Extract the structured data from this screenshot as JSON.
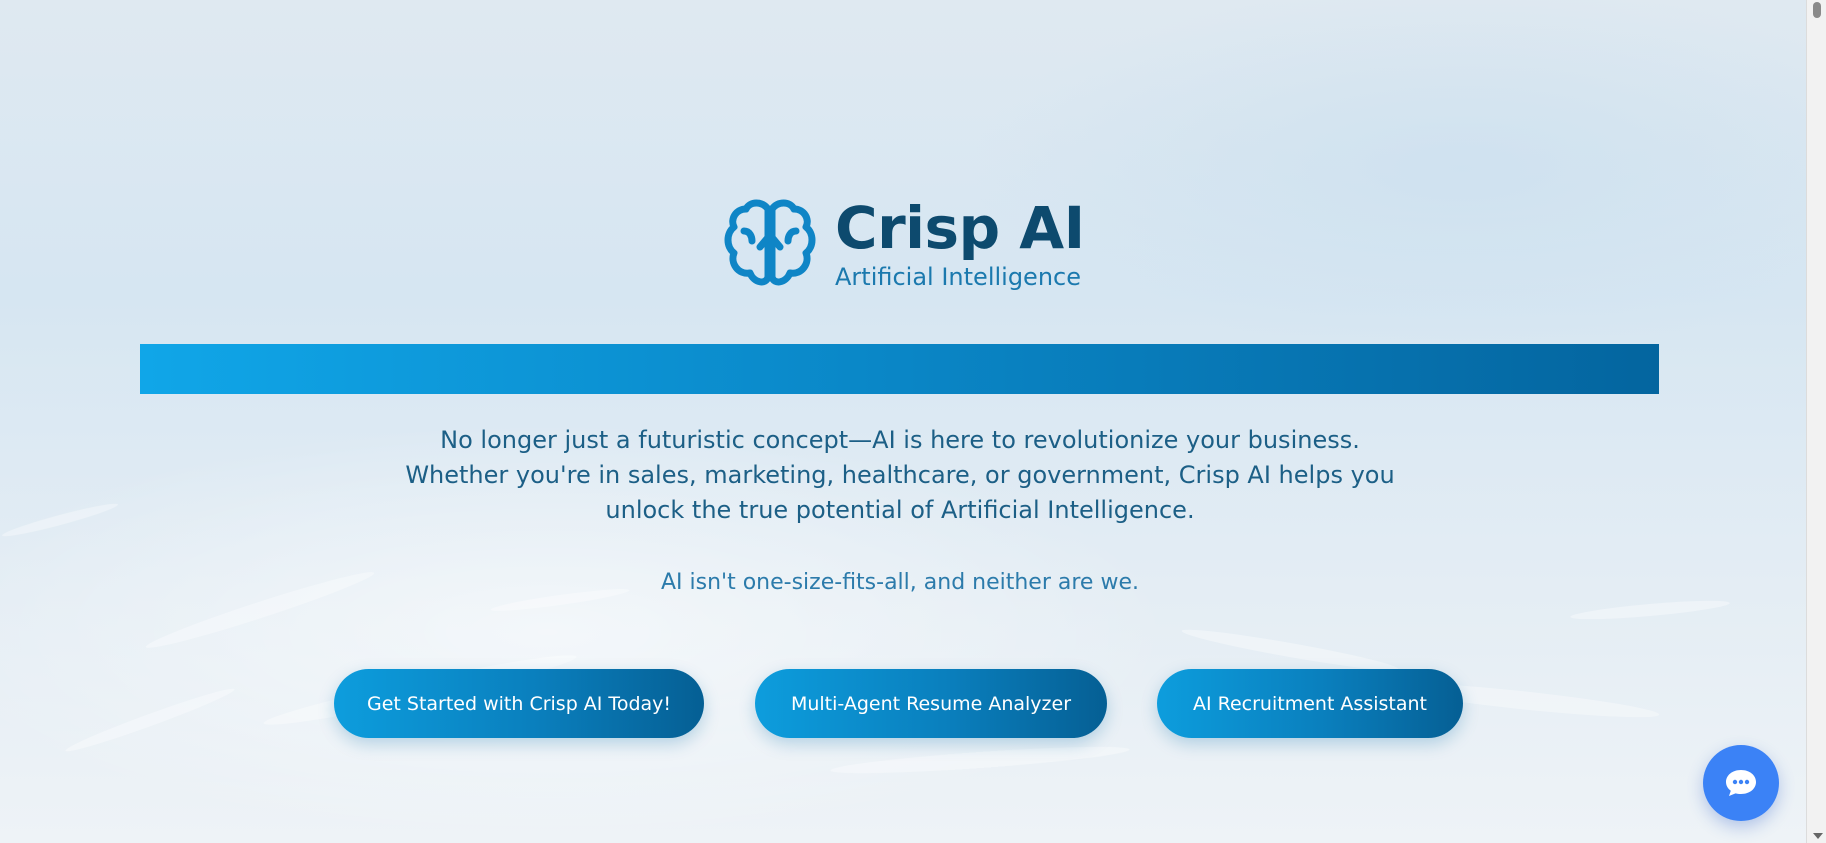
{
  "brand": {
    "title": "Crisp AI",
    "subtitle": "Artificial Intelligence",
    "logo_icon": "brain-icon"
  },
  "hero": {
    "intro": "No longer just a futuristic concept—AI is here to revolutionize your business. Whether you're in sales, marketing, healthcare, or government, Crisp AI helps you unlock the true potential of Artificial Intelligence.",
    "tagline": "AI isn't one-size-fits-all, and neither are we."
  },
  "buttons": [
    {
      "label": "Get Started with Crisp AI Today!"
    },
    {
      "label": "Multi-Agent Resume Analyzer"
    },
    {
      "label": "AI Recruitment Assistant"
    }
  ],
  "chat": {
    "icon": "chat-bubble-icon"
  },
  "colors": {
    "brand_dark": "#0d4a6e",
    "brand_accent": "#1b79ae",
    "banner_start": "#10a6e8",
    "banner_end": "#04659f",
    "chat_button": "#3b82f6"
  }
}
